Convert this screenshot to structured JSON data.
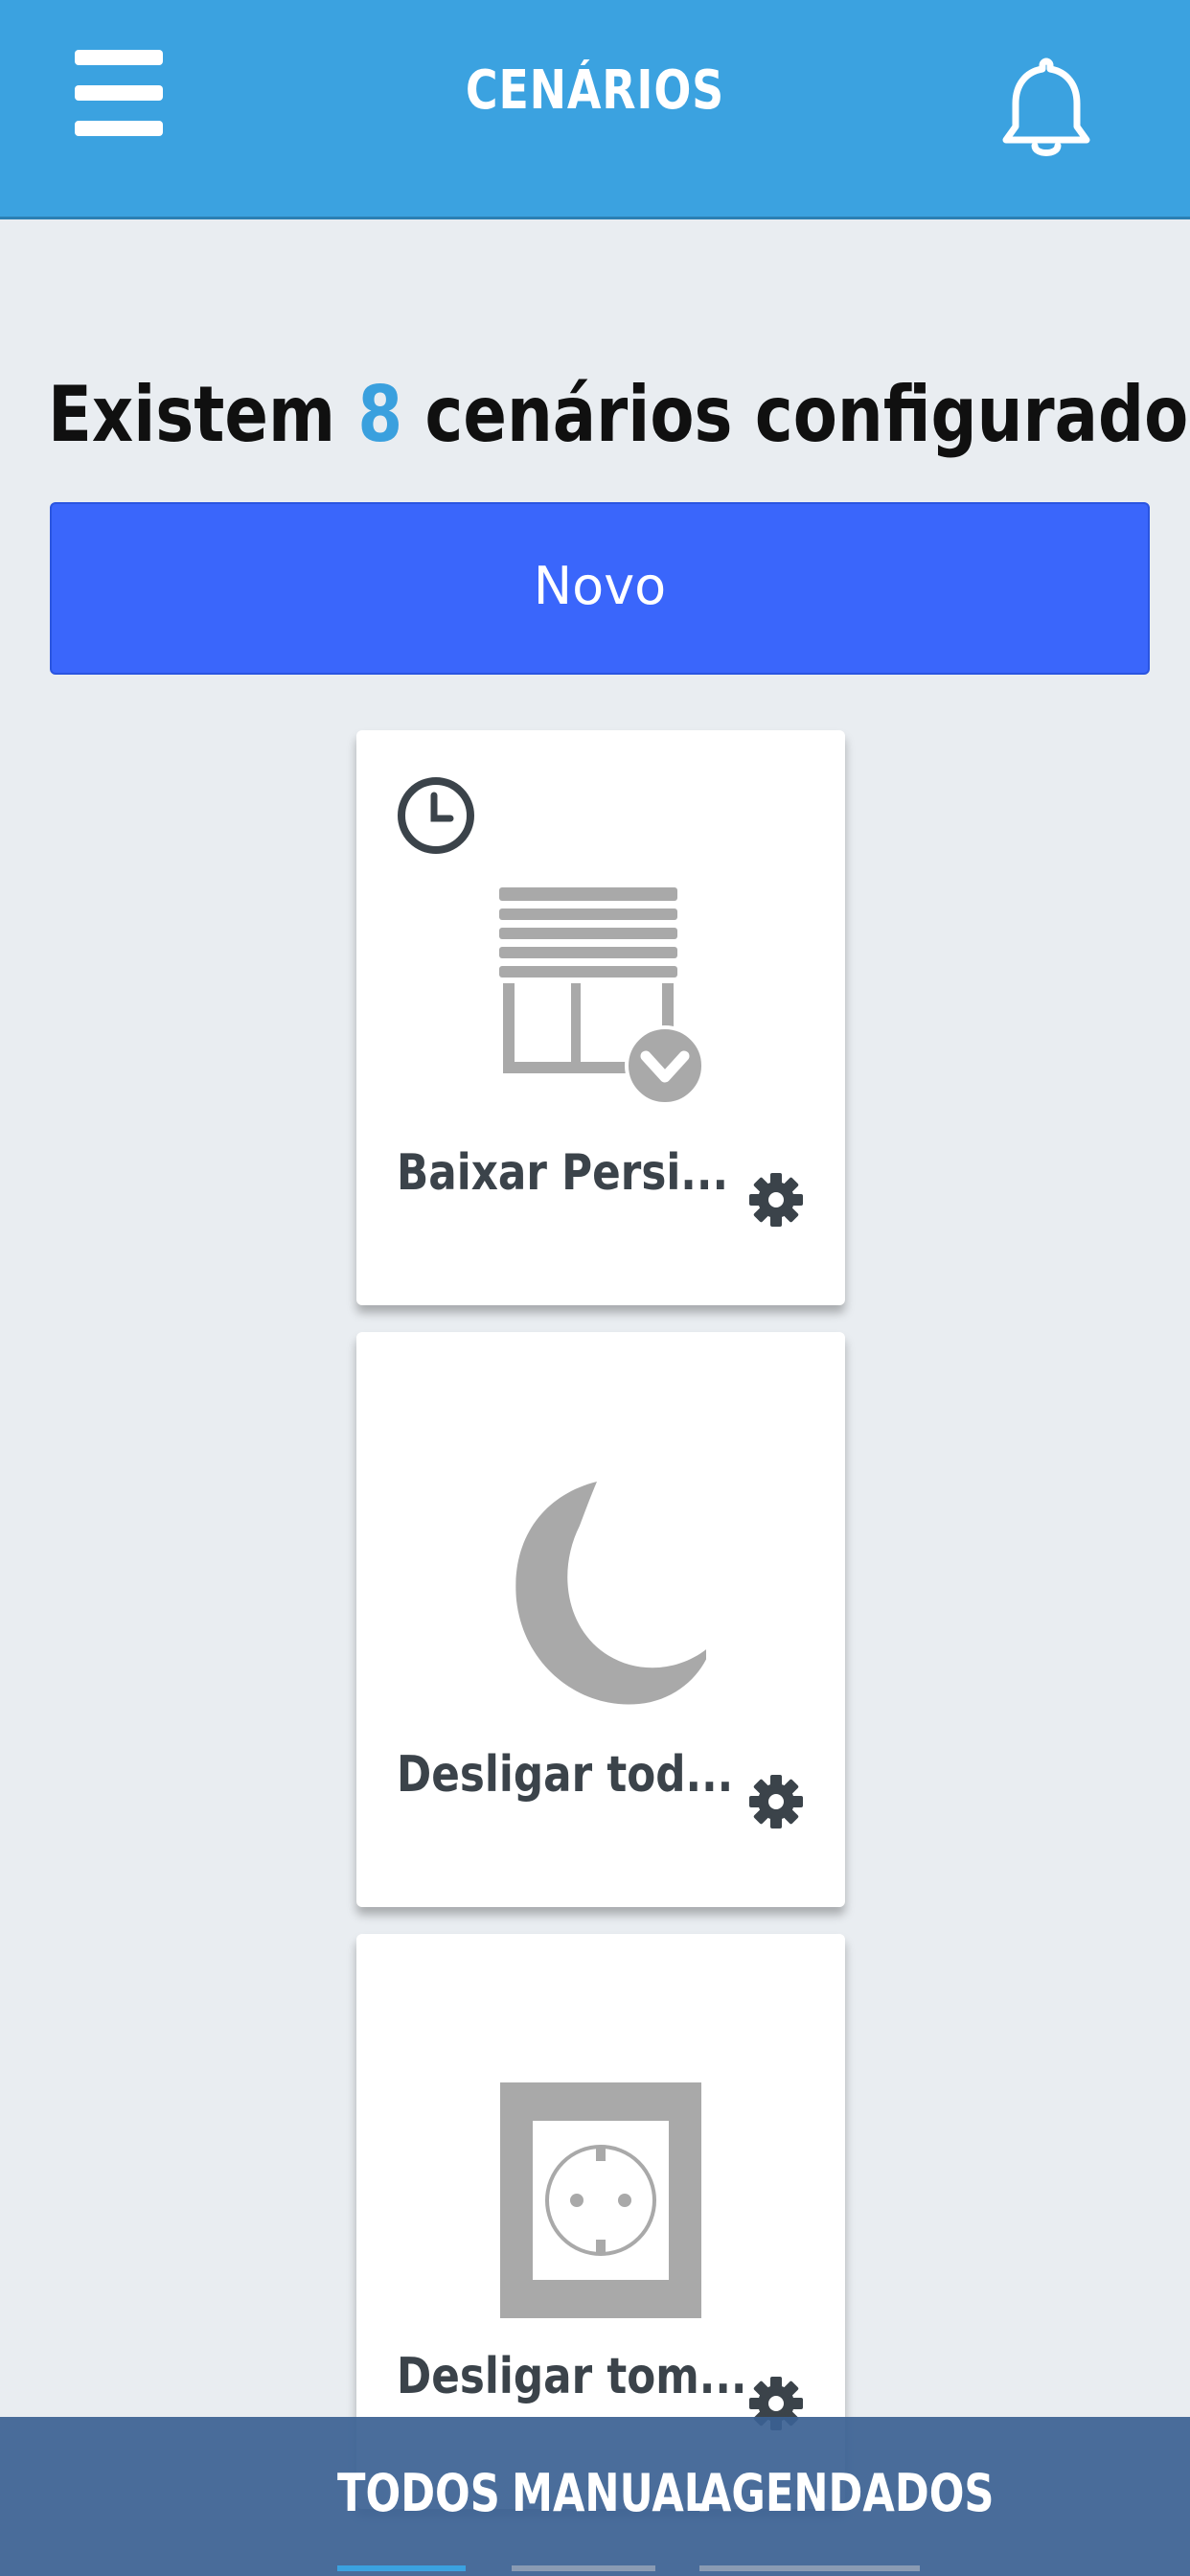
{
  "header": {
    "title": "CENÁRIOS",
    "menu_icon": "hamburger-menu-icon",
    "notifications_icon": "bell-icon"
  },
  "summary": {
    "prefix": "Existem ",
    "count": "8",
    "suffix": " cenários configurados"
  },
  "new_button": {
    "label": "Novo"
  },
  "scenarios": [
    {
      "name": "Baixar Persi...",
      "icon": "blinds-down-icon",
      "scheduled": true
    },
    {
      "name": "Desligar tod...",
      "icon": "moon-icon",
      "scheduled": false
    },
    {
      "name": "Desligar tom...",
      "icon": "power-outlet-icon",
      "scheduled": false
    }
  ],
  "bottom_tabs": [
    {
      "label": "TODOS",
      "active": true
    },
    {
      "label": "MANUAL",
      "active": false
    },
    {
      "label": "AGENDADOS",
      "active": false
    }
  ],
  "colors": {
    "header_bg": "#3ba2e0",
    "accent": "#3aa0de",
    "button_bg": "#3a66fb",
    "icon_gray": "#a9a9a9",
    "dark_icon": "#3b434a",
    "tab_bar_bg": "#3b6193"
  }
}
